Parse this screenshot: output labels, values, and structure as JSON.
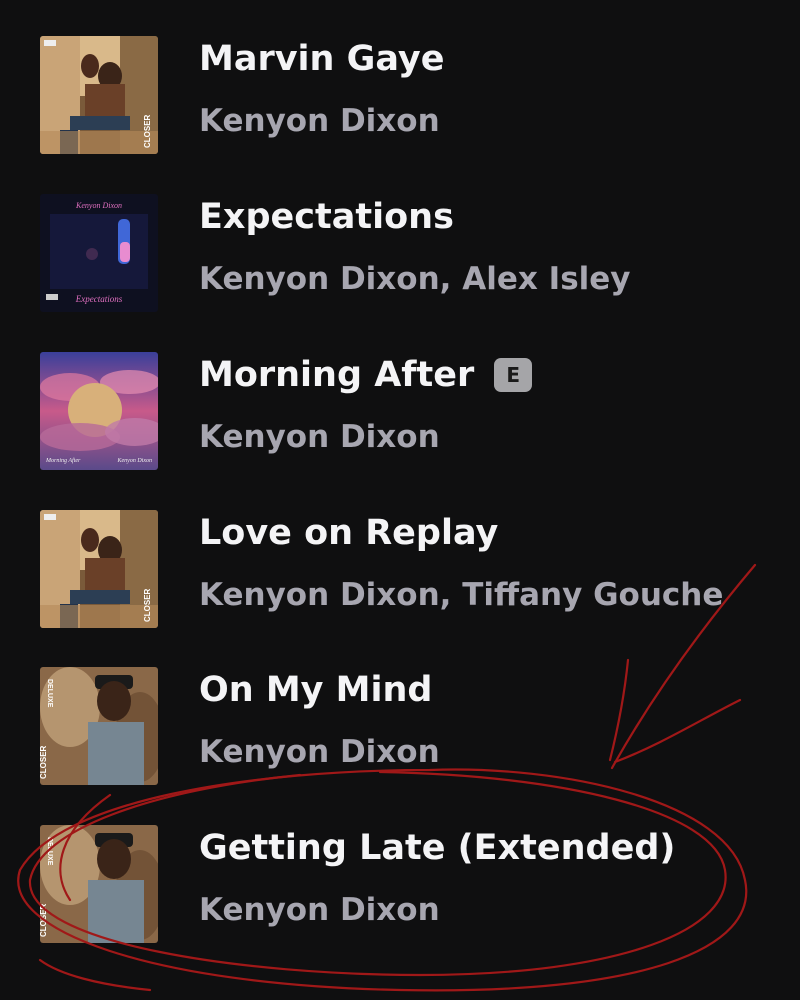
{
  "tracks": [
    {
      "title": "Marvin Gaye",
      "artist": "Kenyon Dixon",
      "explicit": false,
      "art": "closer-couple-cover"
    },
    {
      "title": "Expectations",
      "artist": "Kenyon Dixon, Alex Isley",
      "explicit": false,
      "art": "expectations-cover",
      "art_text_top": "Kenyon Dixon",
      "art_text_bottom": "Expectations"
    },
    {
      "title": "Morning After",
      "artist": "Kenyon Dixon",
      "explicit": true,
      "explicit_label": "E",
      "art": "morning-after-cover",
      "art_text_left": "Morning After",
      "art_text_right": "Kenyon Dixon"
    },
    {
      "title": "Love on Replay",
      "artist": "Kenyon Dixon, Tiffany Gouche",
      "explicit": false,
      "art": "closer-couple-cover"
    },
    {
      "title": "On My Mind",
      "artist": "Kenyon Dixon",
      "explicit": false,
      "art": "closer-deluxe-cover",
      "art_text_top": "DELUXE",
      "art_text_bottom": "CLOSER"
    },
    {
      "title": "Getting Late (Extended)",
      "artist": "Kenyon Dixon",
      "explicit": false,
      "art": "closer-deluxe-cover",
      "art_text_top": "DELUXE",
      "art_text_bottom": "CLOSER"
    }
  ],
  "annotation": {
    "color": "#a01818",
    "shape": "red-hand-drawn-circle-with-arrow"
  }
}
